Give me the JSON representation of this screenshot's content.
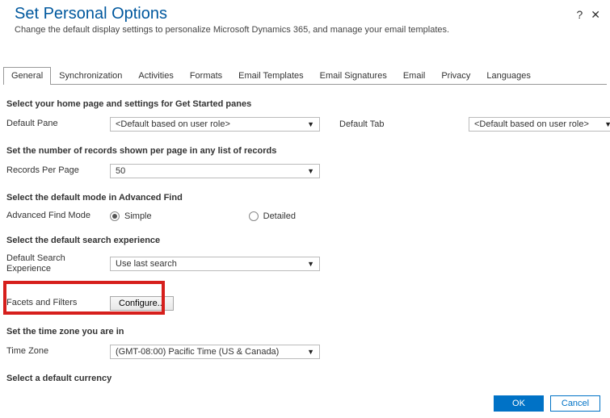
{
  "header": {
    "title": "Set Personal Options",
    "subtitle": "Change the default display settings to personalize Microsoft Dynamics 365, and manage your email templates.",
    "help_icon": "?",
    "close_icon": "✕"
  },
  "tabs": [
    "General",
    "Synchronization",
    "Activities",
    "Formats",
    "Email Templates",
    "Email Signatures",
    "Email",
    "Privacy",
    "Languages"
  ],
  "sections": {
    "s1_title": "Select your home page and settings for Get Started panes",
    "s1_pane_label": "Default Pane",
    "s1_pane_value": "<Default based on user role>",
    "s1_tab_label": "Default Tab",
    "s1_tab_value": "<Default based on user role>",
    "s2_title": "Set the number of records shown per page in any list of records",
    "s2_rpp_label": "Records Per Page",
    "s2_rpp_value": "50",
    "s3_title": "Select the default mode in Advanced Find",
    "s3_afm_label": "Advanced Find Mode",
    "s3_radio_simple": "Simple",
    "s3_radio_detailed": "Detailed",
    "s4_title": "Select the default search experience",
    "s4_dse_label": "Default Search Experience",
    "s4_dse_value": "Use last search",
    "s4_faf_label": "Facets and Filters",
    "s4_configure": "Configure...",
    "s5_title": "Set the time zone you are in",
    "s5_tz_label": "Time Zone",
    "s5_tz_value": "(GMT-08:00) Pacific Time (US & Canada)",
    "s6_title": "Select a default currency"
  },
  "footer": {
    "ok": "OK",
    "cancel": "Cancel"
  }
}
